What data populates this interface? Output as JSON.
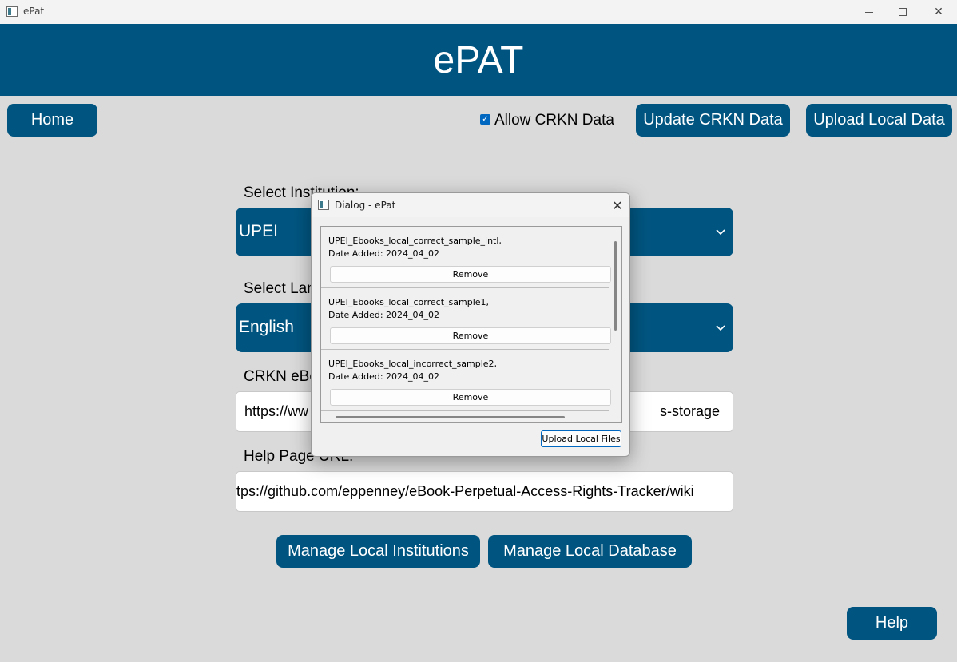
{
  "window": {
    "title": "ePat"
  },
  "header": {
    "title": "ePAT"
  },
  "toolbar": {
    "home_label": "Home",
    "allow_crkn_label": "Allow CRKN Data",
    "allow_crkn_checked": true,
    "update_crkn_label": "Update CRKN Data",
    "upload_local_label": "Upload Local Data"
  },
  "form": {
    "institution_label": "Select Institution:",
    "institution_value": "UPEI",
    "language_label": "Select Language:",
    "language_value": "English",
    "crkn_url_label": "CRKN eBook URL:",
    "crkn_url_left": "https://ww",
    "crkn_url_right": "s-storage",
    "help_url_label": "Help Page URL:",
    "help_url_value": "https://github.com/eppenney/eBook-Perpetual-Access-Rights-Tracker/wiki"
  },
  "actions": {
    "manage_institutions_label": "Manage Local Institutions",
    "manage_database_label": "Manage Local Database",
    "help_label": "Help"
  },
  "dialog": {
    "title": "Dialog - ePat",
    "items": [
      {
        "name": "UPEI_Ebooks_local_correct_sample_intl,",
        "date": "Date Added: 2024_04_02",
        "remove_label": "Remove"
      },
      {
        "name": "UPEI_Ebooks_local_correct_sample1,",
        "date": "Date Added: 2024_04_02",
        "remove_label": "Remove"
      },
      {
        "name": "UPEI_Ebooks_local_incorrect_sample2,",
        "date": "Date Added: 2024_04_02",
        "remove_label": "Remove"
      }
    ],
    "upload_files_label": "Upload Local Files"
  },
  "colors": {
    "primary": "#005580",
    "background": "#dadada",
    "checkbox": "#0067c0"
  },
  "icons": [
    "app-icon",
    "minimize-icon",
    "maximize-icon",
    "close-icon",
    "chevron-down-icon",
    "checkmark-icon"
  ]
}
